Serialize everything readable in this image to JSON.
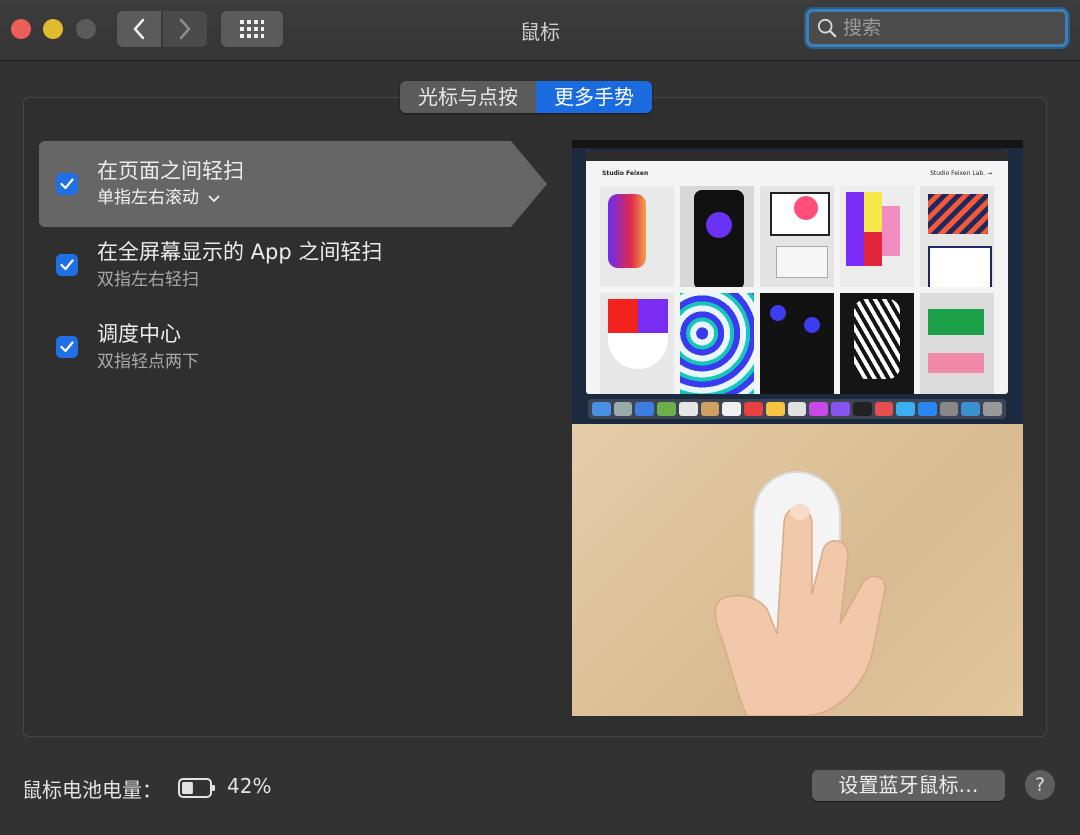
{
  "window": {
    "title": "鼠标"
  },
  "search": {
    "placeholder": "搜索"
  },
  "tabs": [
    {
      "label": "光标与点按",
      "active": false
    },
    {
      "label": "更多手势",
      "active": true
    }
  ],
  "gestures": [
    {
      "title": "在页面之间轻扫",
      "subtitle": "单指左右滚动",
      "checked": true,
      "selected": true,
      "has_dropdown": true
    },
    {
      "title": "在全屏幕显示的 App 之间轻扫",
      "subtitle": "双指左右轻扫",
      "checked": true,
      "selected": false
    },
    {
      "title": "调度中心",
      "subtitle": "双指轻点两下",
      "checked": true,
      "selected": false
    }
  ],
  "preview": {
    "site_name": "Studio Feixen",
    "site_link": "Studio Feixen Lab. →"
  },
  "battery": {
    "label": "鼠标电池电量：",
    "percent_text": "42%",
    "level": 0.42
  },
  "buttons": {
    "setup_bluetooth": "设置蓝牙鼠标…",
    "help": "?"
  },
  "colors": {
    "accent": "#1a6be0",
    "checkbox": "#1f6fe5",
    "close": "#ec5f59",
    "minimize": "#e0bb2f"
  }
}
